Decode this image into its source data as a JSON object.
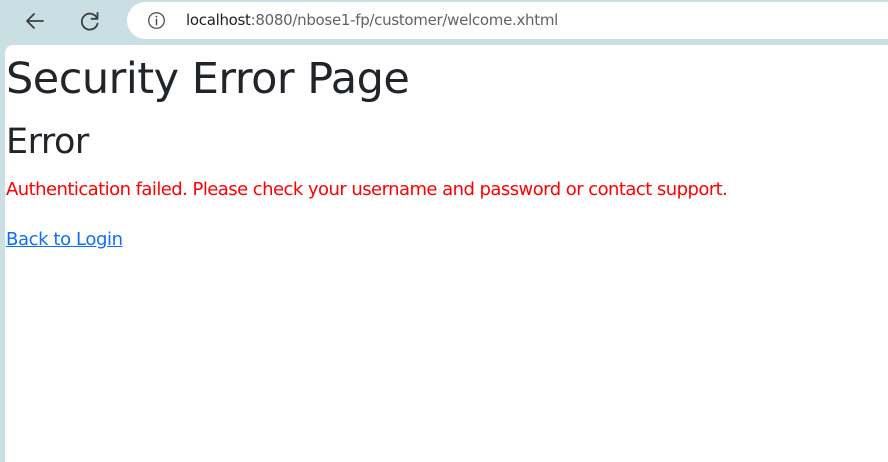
{
  "browser": {
    "back_icon": "arrow-left-icon",
    "reload_icon": "reload-icon",
    "site_info_icon": "info-icon",
    "url_host": "localhost",
    "url_rest": ":8080/nbose1-fp/customer/welcome.xhtml"
  },
  "page": {
    "title": "Security Error Page",
    "error_heading": "Error",
    "error_message": "Authentication failed. Please check your username and password or contact support.",
    "back_link_label": "Back to Login"
  },
  "colors": {
    "chrome_background": "#c9dfe4",
    "heading_text": "#212529",
    "error_text": "#ff0000",
    "link": "#0d6efd"
  }
}
